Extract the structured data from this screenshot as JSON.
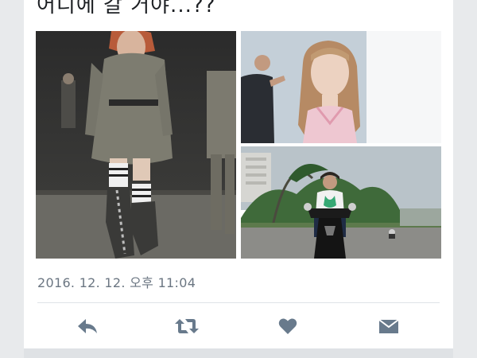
{
  "tweet": {
    "text": "어디에 갈 거야...??",
    "timestamp": "2016. 12. 12. 오후 11:04"
  },
  "media": [
    {
      "icon": "runway-model-photo"
    },
    {
      "icon": "studio-portrait-photo"
    },
    {
      "icon": "scooter-street-photo"
    }
  ],
  "actions": [
    {
      "icon": "reply-icon"
    },
    {
      "icon": "retweet-icon"
    },
    {
      "icon": "heart-icon"
    },
    {
      "icon": "message-icon"
    }
  ],
  "colors": {
    "icon": "#687a8c",
    "text": "#1c1f23",
    "meta": "#6b7682",
    "background": "#ffffff"
  }
}
